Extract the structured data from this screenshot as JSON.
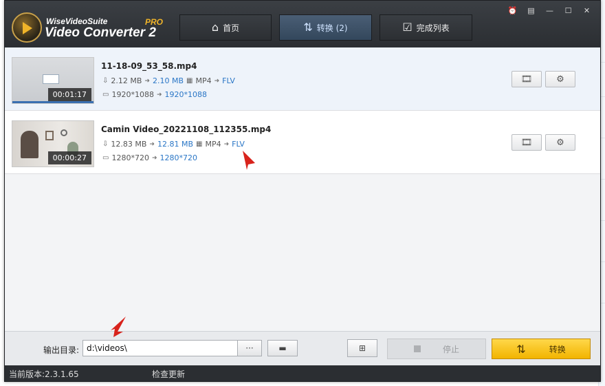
{
  "app": {
    "suite_name": "WiseVideoSuite",
    "product_name": "Video Converter 2",
    "edition": "PRO"
  },
  "nav": {
    "home_label": "首页",
    "convert_label": "转换 (2)",
    "done_label": "完成列表"
  },
  "files": [
    {
      "name": "11-18-09_53_58.mp4",
      "duration": "00:01:17",
      "size_src": "2.12 MB",
      "size_dst": "2.10 MB",
      "format_src": "MP4",
      "format_dst": "FLV",
      "res_src": "1920*1088",
      "res_dst": "1920*1088"
    },
    {
      "name": "Camin Video_20221108_112355.mp4",
      "duration": "00:00:27",
      "size_src": "12.83 MB",
      "size_dst": "12.81 MB",
      "format_src": "MP4",
      "format_dst": "FLV",
      "res_src": "1280*720",
      "res_dst": "1280*720"
    }
  ],
  "toolbar": {
    "output_label": "输出目录:",
    "output_path": "d:\\videos\\",
    "browse_label": "···",
    "stop_label": "停止",
    "convert_label": "转换"
  },
  "status": {
    "version": "当前版本:2.3.1.65",
    "check_update": "检查更新"
  },
  "colors": {
    "accent_blue": "#2a76c6",
    "convert_yellow": "#f2b400",
    "titlebar": "#2e3135"
  }
}
